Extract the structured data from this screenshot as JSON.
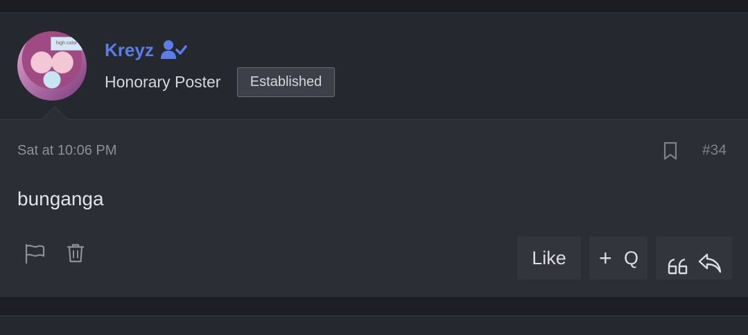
{
  "post": {
    "username": "Kreyz",
    "user_title": "Honorary Poster",
    "user_banner": "Established",
    "avatar_badge_text": "high color",
    "date": "Sat at 10:06 PM",
    "post_number": "#34",
    "message": "bunganga",
    "actions": {
      "like_label": "Like",
      "multiquote_plus": "+",
      "multiquote_label": "Q"
    }
  },
  "colors": {
    "username": "#5b7ee6",
    "background": "#2c2e36",
    "header_background": "#26282f"
  },
  "icons": [
    "user-verified-icon",
    "bookmark-icon",
    "flag-icon",
    "trash-icon",
    "quote-icon",
    "reply-icon"
  ]
}
